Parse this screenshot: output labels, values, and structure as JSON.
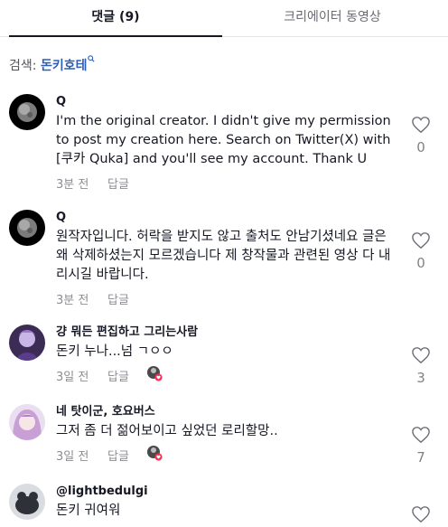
{
  "tabs": [
    {
      "label": "댓글 (9)"
    },
    {
      "label": "크리에이터 동영상"
    }
  ],
  "search": {
    "prefix": "검색:",
    "keyword": "돈키호테"
  },
  "comments": [
    {
      "username": "Q",
      "text": "I'm the original creator. I didn't give my permission to post my creation here. Search on Twitter(X) with [쿠카 Quka] and you'll see my account. Thank U",
      "time": "3분 전",
      "reply": "답글",
      "likes": "0"
    },
    {
      "username": "Q",
      "text": "원작자입니다. 허락을 받지도 않고 출처도 안남기셨네요 글은 왜 삭제하셨는지 모르겠습니다 제 창작물과 관련된 영상 다 내리시길 바랍니다.",
      "time": "3분 전",
      "reply": "답글",
      "likes": "0"
    },
    {
      "username": "걍 뭐든 편집하고 그리는사람",
      "text": "돈키 누나...넘 ㄱㅇㅇ",
      "time": "3일 전",
      "reply": "답글",
      "likes": "3"
    },
    {
      "username": "네 탓이군, 호요버스",
      "text": "그저 좀 더 젊어보이고 싶었던 로리할망..",
      "time": "3일 전",
      "reply": "답글",
      "likes": "7"
    },
    {
      "username": "@lightbedulgi",
      "text": "돈키 귀여워",
      "time": "",
      "reply": "",
      "likes": ""
    }
  ]
}
